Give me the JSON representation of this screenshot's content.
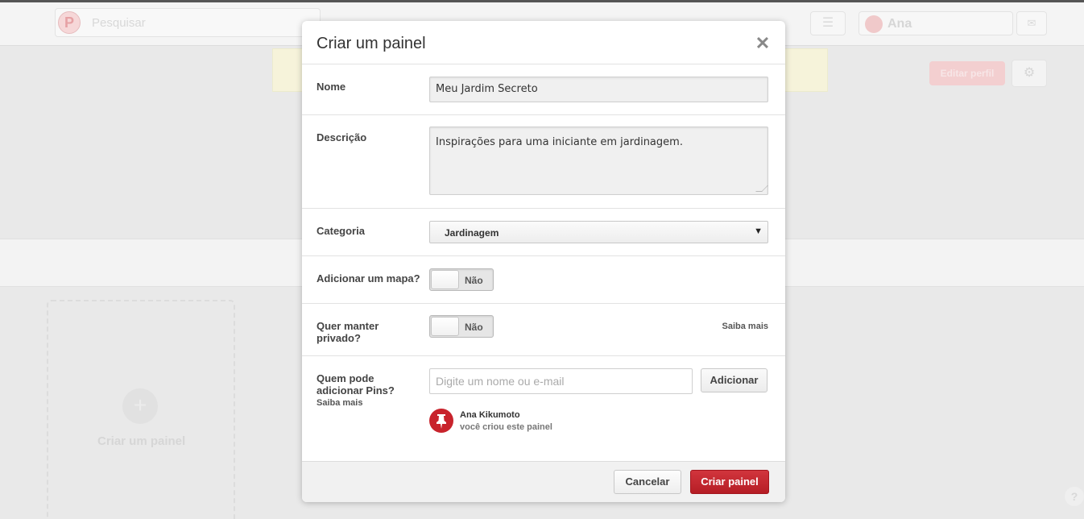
{
  "background": {
    "search_placeholder": "Pesquisar",
    "user_name": "Ana",
    "edit_profile_label": "Editar perfil",
    "create_board_label": "Criar um painel"
  },
  "modal": {
    "title": "Criar um painel",
    "close_icon": "close-icon",
    "name": {
      "label": "Nome",
      "value": "Meu Jardim Secreto"
    },
    "description": {
      "label": "Descrição",
      "value": "Inspirações para uma iniciante em jardinagem."
    },
    "category": {
      "label": "Categoria",
      "selected": "Jardinagem"
    },
    "map": {
      "label": "Adicionar um mapa?",
      "toggle_value": "Não"
    },
    "private": {
      "label": "Quer manter privado?",
      "toggle_value": "Não",
      "learn_more": "Saiba mais"
    },
    "collaborators": {
      "label": "Quem pode adicionar Pins?",
      "learn_more": "Saiba mais",
      "input_placeholder": "Digite um nome ou e-mail",
      "add_button": "Adicionar",
      "owner_name": "Ana Kikumoto",
      "owner_note": "você criou este painel"
    },
    "footer": {
      "cancel_button": "Cancelar",
      "create_button": "Criar painel"
    }
  },
  "colors": {
    "brand_red": "#bd2028",
    "overlay_gray": "#e9e9e9"
  }
}
